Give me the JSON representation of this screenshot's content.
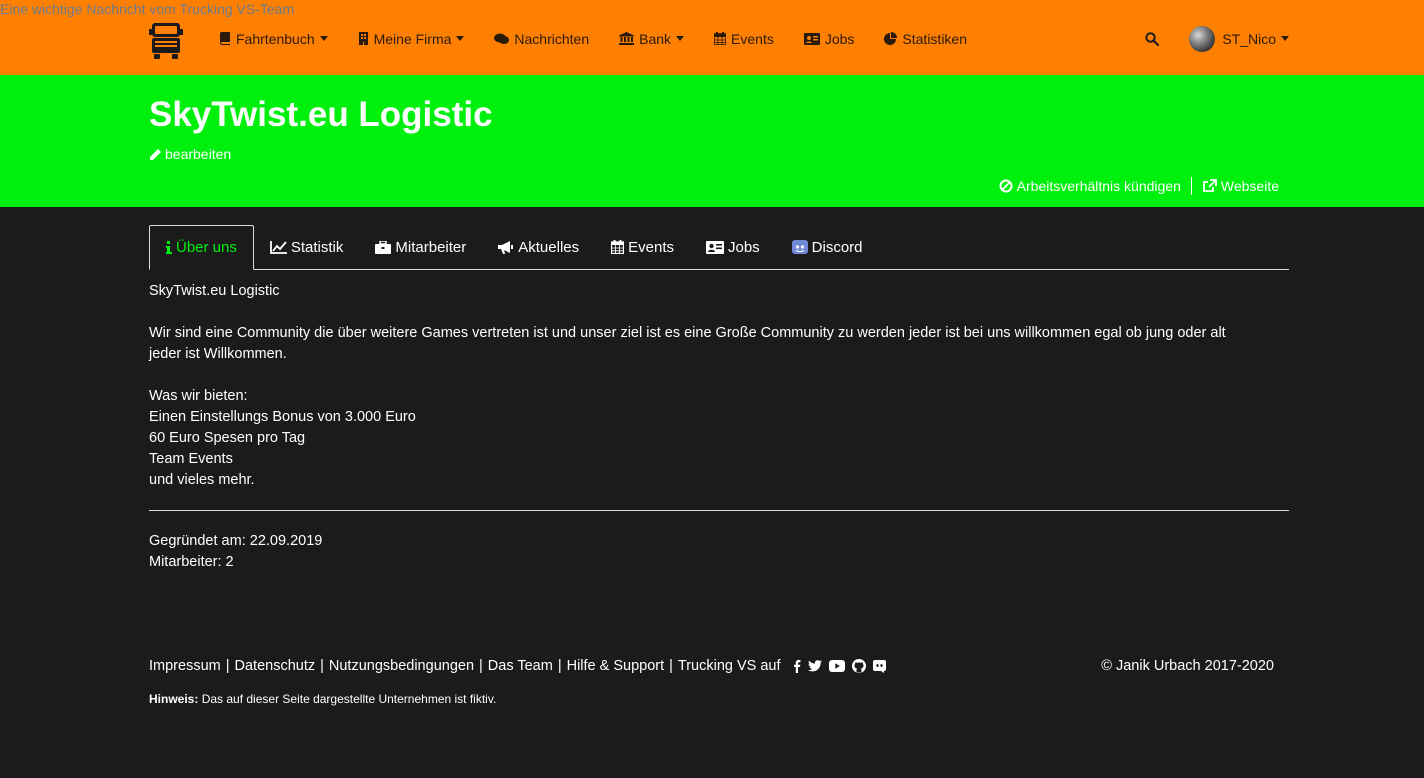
{
  "notice": "Eine wichtige Nachricht vom Trucking VS-Team",
  "nav": {
    "items": [
      {
        "label": "Fahrtenbuch",
        "icon": "book-icon",
        "dropdown": true
      },
      {
        "label": "Meine Firma",
        "icon": "building-icon",
        "dropdown": true
      },
      {
        "label": "Nachrichten",
        "icon": "comments-icon",
        "dropdown": false
      },
      {
        "label": "Bank",
        "icon": "bank-icon",
        "dropdown": true
      },
      {
        "label": "Events",
        "icon": "calendar-icon",
        "dropdown": false
      },
      {
        "label": "Jobs",
        "icon": "id-card-icon",
        "dropdown": false
      },
      {
        "label": "Statistiken",
        "icon": "pie-chart-icon",
        "dropdown": false
      }
    ],
    "username": "ST_Nico"
  },
  "company": {
    "name": "SkyTwist.eu Logistic",
    "edit_label": "bearbeiten",
    "quit_label": "Arbeitsverhältnis kündigen",
    "website_label": "Webseite"
  },
  "tabs": [
    {
      "label": "Über uns",
      "icon": "info-icon",
      "active": true
    },
    {
      "label": "Statistik",
      "icon": "line-chart-icon",
      "active": false
    },
    {
      "label": "Mitarbeiter",
      "icon": "briefcase-icon",
      "active": false
    },
    {
      "label": "Aktuelles",
      "icon": "bullhorn-icon",
      "active": false
    },
    {
      "label": "Events",
      "icon": "calendar-icon",
      "active": false
    },
    {
      "label": "Jobs",
      "icon": "id-card-icon",
      "active": false
    },
    {
      "label": "Discord",
      "icon": "discord-icon",
      "active": false
    }
  ],
  "about": {
    "heading": "SkyTwist.eu Logistic",
    "paragraph_1": "Wir sind eine Community die über weitere Games vertreten ist und unser ziel ist es eine Große Community zu werden jeder ist bei uns willkommen egal ob jung oder alt",
    "paragraph_2": "jeder ist Willkommen.",
    "offer_title": "Was wir bieten:",
    "offers": [
      "Einen Einstellungs Bonus von 3.000 Euro",
      "60 Euro Spesen pro Tag",
      "Team Events",
      "und vieles mehr."
    ]
  },
  "meta": {
    "founded": "Gegründet am: 22.09.2019",
    "employees": "Mitarbeiter: 2"
  },
  "footer": {
    "links": [
      "Impressum",
      "Datenschutz",
      "Nutzungsbedingungen",
      "Das Team",
      "Hilfe & Support"
    ],
    "social_label": "Trucking VS auf",
    "copyright": "© Janik Urbach 2017-2020",
    "hint_label": "Hinweis:",
    "hint_text": "Das auf dieser Seite dargestellte Unternehmen ist fiktiv."
  },
  "colors": {
    "navbar": "#ff8000",
    "hero": "#00f00d",
    "background": "#1b1b1b",
    "active_tab": "#00f00d"
  }
}
